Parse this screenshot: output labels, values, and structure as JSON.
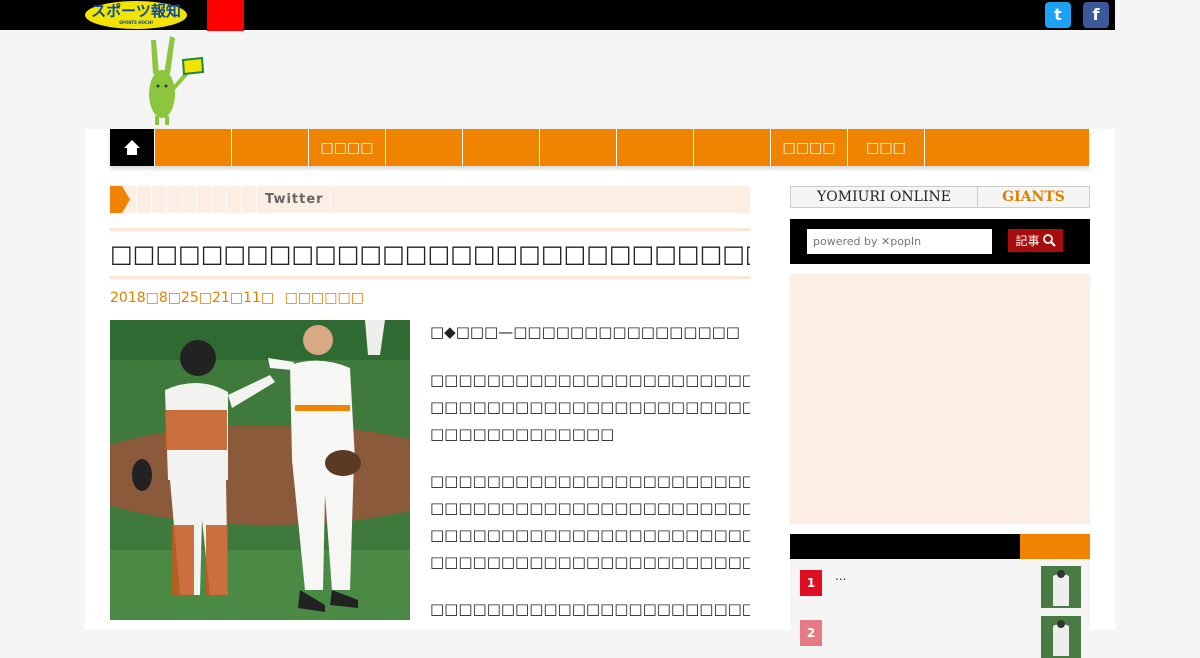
{
  "header": {
    "logo_text": "スポーツ報知",
    "logo_sub": "SPORTS HOCHI",
    "twitter_icon_label": "t",
    "facebook_icon_label": "f"
  },
  "nav": {
    "items": [
      "",
      "",
      "□□□□",
      "",
      "",
      "",
      "",
      "",
      "□□□□",
      "□□□",
      ""
    ]
  },
  "breadcrumb": {
    "label": "Twitter"
  },
  "article": {
    "title": "□□□□□□□□□□□□□□□□□□□□□□□□□□□□□□□□□□□□□□□",
    "date": "2018□8□25□21□11□",
    "source": "□□□□□□",
    "lead": "□◆□□□—□□□□□□□□□□□□□□□□",
    "paragraphs": [
      [
        "□□□□□□□□□□□□□□□□□□□□□□□□□□□□□□□□□",
        "□□□□□□□□□□□□□□□□□□□□□□□□□□□□□□□□□□□□",
        "□□□□□□□□□□□□□"
      ],
      [
        "□□□□□□□□□□□□□□□□□□□□□□□□□□□□□□□□□□□□",
        "□□□□□□□□□□□□□□□□□□□□□□□□□□□□□□□□□□□□",
        "□□□□□□□□□□□□□□□□□□□□□□□□□□□□□□□□□□□□",
        "□□□□□□□□□□□□□□□□□□□□□□□□□□□□□□□□□"
      ],
      [
        "□□□□□□□□□□□□□□□□□□□□□□□□□□□□□□□□□□□□"
      ]
    ]
  },
  "sidebar": {
    "tab_yomiuri": "YOMIURI ONLINE",
    "tab_giants": "GIANTS",
    "search_placeholder": "powered by ✕popIn",
    "search_button": "記事",
    "ranking": [
      {
        "rank": "1",
        "text": "...",
        "badge_color": "#e00d23"
      },
      {
        "rank": "2",
        "text": "",
        "badge_color": "#e87a86"
      }
    ]
  }
}
